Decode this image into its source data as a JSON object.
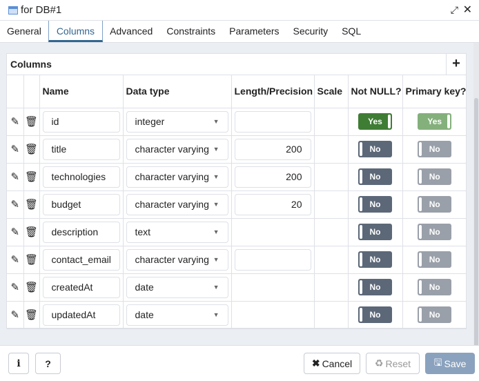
{
  "title": "for DB#1",
  "tabs": [
    "General",
    "Columns",
    "Advanced",
    "Constraints",
    "Parameters",
    "Security",
    "SQL"
  ],
  "active_tab": "Columns",
  "panel": {
    "title": "Columns",
    "add_label": "+"
  },
  "headers": {
    "name": "Name",
    "type": "Data type",
    "length": "Length/Precision",
    "scale": "Scale",
    "notnull": "Not NULL?",
    "pk": "Primary key?"
  },
  "rows": [
    {
      "name": "id",
      "type": "integer",
      "length": "",
      "notnull": "Yes",
      "pk": "Yes"
    },
    {
      "name": "title",
      "type": "character varying",
      "length": "200",
      "notnull": "No",
      "pk": "No"
    },
    {
      "name": "technologies",
      "type": "character varying",
      "length": "200",
      "notnull": "No",
      "pk": "No"
    },
    {
      "name": "budget",
      "type": "character varying",
      "length": "20",
      "notnull": "No",
      "pk": "No"
    },
    {
      "name": "description",
      "type": "text",
      "length": null,
      "notnull": "No",
      "pk": "No"
    },
    {
      "name": "contact_email",
      "type": "character varying",
      "length": "",
      "notnull": "No",
      "pk": "No"
    },
    {
      "name": "createdAt",
      "type": "date",
      "length": null,
      "notnull": "No",
      "pk": "No"
    },
    {
      "name": "updatedAt",
      "type": "date",
      "length": null,
      "notnull": "No",
      "pk": "No"
    }
  ],
  "footer": {
    "info": "i",
    "help": "?",
    "cancel": "Cancel",
    "reset": "Reset",
    "save": "Save"
  },
  "colors": {
    "yes_on": "#3f7d35",
    "yes_disabled": "#84b07c",
    "no_on": "#5c6878",
    "no_disabled": "#9aa0a9",
    "save": "#8aa2bd"
  }
}
